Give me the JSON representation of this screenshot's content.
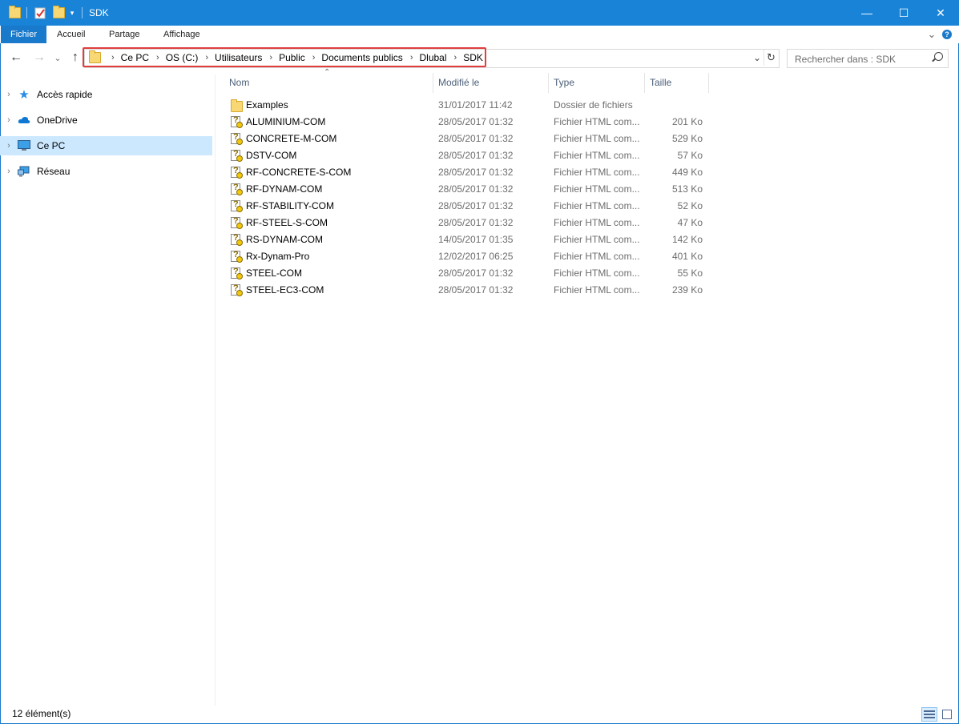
{
  "window": {
    "title": "SDK",
    "minimize_glyph": "—",
    "maximize_glyph": "☐",
    "close_glyph": "✕"
  },
  "ribbon": {
    "tabs": [
      "Fichier",
      "Accueil",
      "Partage",
      "Affichage"
    ],
    "expand_glyph": "⌄",
    "help_glyph": "?"
  },
  "nav": {
    "back_glyph": "←",
    "forward_glyph": "→",
    "recent_glyph": "⌄",
    "up_glyph": "↑"
  },
  "address": {
    "crumbs": [
      "Ce PC",
      "OS (C:)",
      "Utilisateurs",
      "Public",
      "Documents publics",
      "Dlubal",
      "SDK"
    ],
    "separator": "›",
    "dropdown_glyph": "⌄",
    "refresh_glyph": "↻",
    "highlight_color": "#e03e3e"
  },
  "search": {
    "placeholder": "Rechercher dans : SDK",
    "value": ""
  },
  "sidebar": {
    "items": [
      {
        "label": "Accès rapide",
        "icon": "star-icon",
        "selected": false
      },
      {
        "label": "OneDrive",
        "icon": "cloud-icon",
        "selected": false
      },
      {
        "label": "Ce PC",
        "icon": "computer-icon",
        "selected": true
      },
      {
        "label": "Réseau",
        "icon": "network-icon",
        "selected": false
      }
    ],
    "chevron_glyph": "›"
  },
  "columns": {
    "name": "Nom",
    "modified": "Modifié le",
    "type": "Type",
    "size": "Taille",
    "sort_glyph": "⌃"
  },
  "files": [
    {
      "name": "Examples",
      "modified": "31/01/2017 11:42",
      "type": "Dossier de fichiers",
      "size": "",
      "icon": "folder-icon"
    },
    {
      "name": "ALUMINIUM-COM",
      "modified": "28/05/2017 01:32",
      "type": "Fichier HTML com...",
      "size": "201 Ko",
      "icon": "html-help-icon"
    },
    {
      "name": "CONCRETE-M-COM",
      "modified": "28/05/2017 01:32",
      "type": "Fichier HTML com...",
      "size": "529 Ko",
      "icon": "html-help-icon"
    },
    {
      "name": "DSTV-COM",
      "modified": "28/05/2017 01:32",
      "type": "Fichier HTML com...",
      "size": "57 Ko",
      "icon": "html-help-icon"
    },
    {
      "name": "RF-CONCRETE-S-COM",
      "modified": "28/05/2017 01:32",
      "type": "Fichier HTML com...",
      "size": "449 Ko",
      "icon": "html-help-icon"
    },
    {
      "name": "RF-DYNAM-COM",
      "modified": "28/05/2017 01:32",
      "type": "Fichier HTML com...",
      "size": "513 Ko",
      "icon": "html-help-icon"
    },
    {
      "name": "RF-STABILITY-COM",
      "modified": "28/05/2017 01:32",
      "type": "Fichier HTML com...",
      "size": "52 Ko",
      "icon": "html-help-icon"
    },
    {
      "name": "RF-STEEL-S-COM",
      "modified": "28/05/2017 01:32",
      "type": "Fichier HTML com...",
      "size": "47 Ko",
      "icon": "html-help-icon"
    },
    {
      "name": "RS-DYNAM-COM",
      "modified": "14/05/2017 01:35",
      "type": "Fichier HTML com...",
      "size": "142 Ko",
      "icon": "html-help-icon"
    },
    {
      "name": "Rx-Dynam-Pro",
      "modified": "12/02/2017 06:25",
      "type": "Fichier HTML com...",
      "size": "401 Ko",
      "icon": "html-help-icon"
    },
    {
      "name": "STEEL-COM",
      "modified": "28/05/2017 01:32",
      "type": "Fichier HTML com...",
      "size": "55 Ko",
      "icon": "html-help-icon"
    },
    {
      "name": "STEEL-EC3-COM",
      "modified": "28/05/2017 01:32",
      "type": "Fichier HTML com...",
      "size": "239 Ko",
      "icon": "html-help-icon"
    }
  ],
  "status": {
    "count": "12 élément(s)"
  },
  "colors": {
    "titlebar": "#1883d7",
    "file_tab": "#1979ca",
    "selection": "#cce8ff",
    "header_text": "#4c607a"
  }
}
